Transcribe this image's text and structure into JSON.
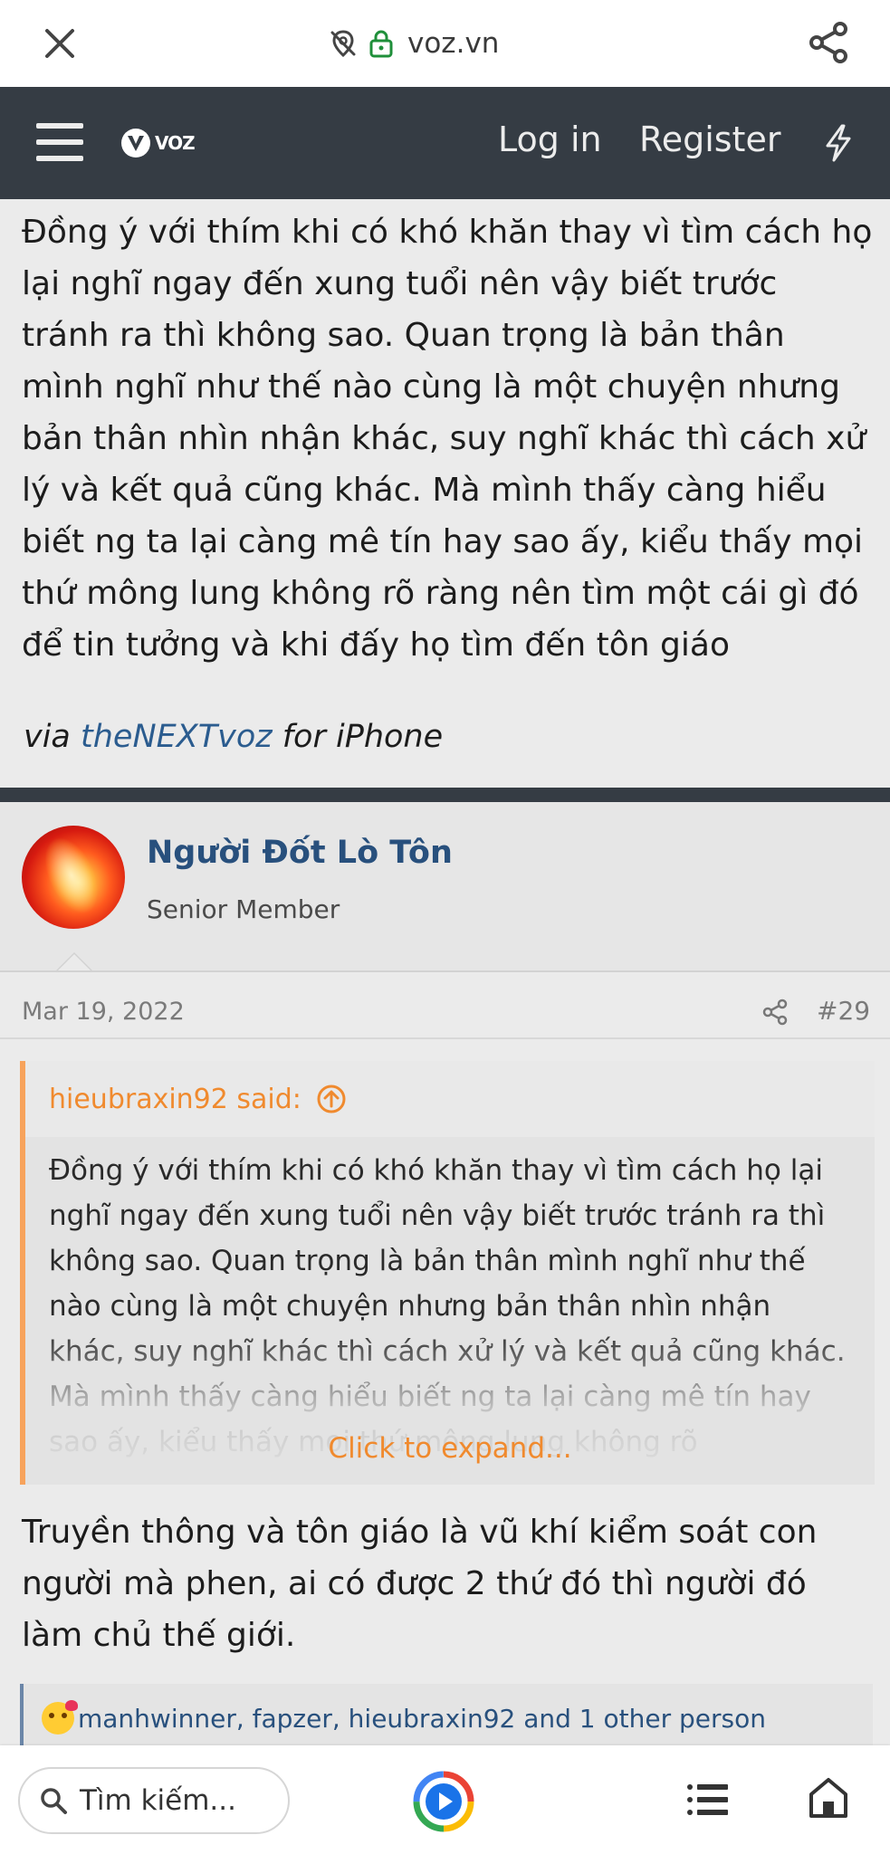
{
  "browser": {
    "url": "voz.vn"
  },
  "header": {
    "logo_text": "VOZ",
    "login_label": "Log in",
    "register_label": "Register"
  },
  "previous_post": {
    "body": "Đồng ý với thím khi có khó khăn thay vì tìm cách họ lại nghĩ ngay đến xung tuổi nên vậy biết trước tránh ra thì không sao. Quan trọng là bản thân mình nghĩ như thế nào cùng là một chuyện nhưng bản thân nhìn nhận khác, suy nghĩ khác thì cách xử lý và kết quả cũng khác. Mà mình thấy càng hiểu biết ng ta lại càng mê tín hay sao ấy, kiểu thấy mọi thứ mông lung không rõ ràng nên tìm một cái gì đó để tin tưởng và khi đấy họ tìm đến tôn giáo",
    "via_prefix": "via ",
    "via_link": "theNEXTvoz",
    "via_suffix": " for iPhone"
  },
  "post": {
    "username": "Người Đốt Lò Tôn",
    "user_title": "Senior Member",
    "date": "Mar 19, 2022",
    "number": "#29",
    "quote": {
      "author": "hieubraxin92 said:",
      "text": "Đồng ý với thím khi có khó khăn thay vì tìm cách họ lại nghĩ ngay đến xung tuổi nên vậy biết trước tránh ra thì không sao. Quan trọng là bản thân mình nghĩ như thế nào cùng là một chuyện nhưng bản thân nhìn nhận khác, suy nghĩ khác thì cách xử lý và kết quả cũng khác. Mà mình thấy càng hiểu biết ng ta lại càng mê tín hay sao ấy, kiểu thấy mọi thứ mông lung không rõ",
      "expand_label": "Click to expand..."
    },
    "body": "Truyền thông và tôn giáo là vũ khí kiểm soát con người mà phen, ai có được 2 thứ đó thì người đó làm chủ thế giới.",
    "reactions": "manhwinner, fapzer, hieubraxin92 and 1 other person"
  },
  "bottom_bar": {
    "search_placeholder": "Tìm kiếm..."
  },
  "colors": {
    "header_bg": "#353c44",
    "link": "#28507d",
    "quote_accent": "#f7a35c"
  }
}
